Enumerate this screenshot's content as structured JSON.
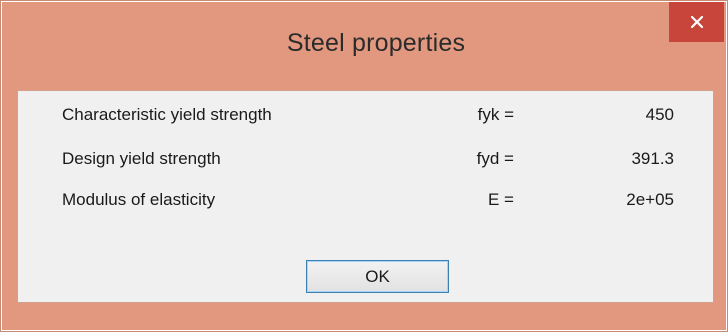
{
  "window": {
    "title": "Steel properties",
    "close_icon": "close-icon"
  },
  "properties": [
    {
      "label": "Characteristic yield strength",
      "symbol": "fyk =",
      "value": "450"
    },
    {
      "label": "Design yield strength",
      "symbol": "fyd =",
      "value": "391.3"
    },
    {
      "label": "Modulus of elasticity",
      "symbol": "E =",
      "value": "2e+05"
    }
  ],
  "buttons": {
    "ok_label": "OK"
  },
  "colors": {
    "frame": "#e2987f",
    "close_button": "#c7453b",
    "client_background": "#f0f0f0",
    "button_border": "#3c7fb1"
  }
}
